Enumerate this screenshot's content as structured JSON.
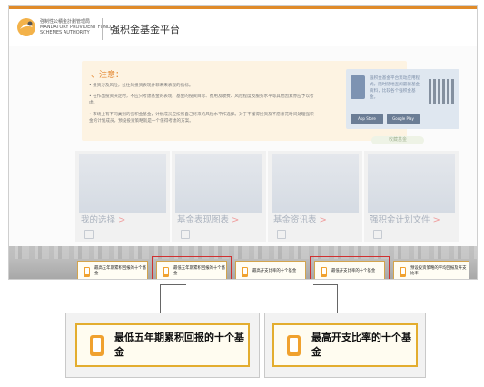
{
  "header": {
    "org_lines": [
      "強制性公積金計劃管理局",
      "MANDATORY PROVIDENT FUND",
      "SCHEMES AUTHORITY"
    ],
    "title": "强积金基金平台"
  },
  "notice": {
    "title": "注意",
    "items": [
      "投资涉及风险，过往的投资表现并非未来表现的指标。",
      "在作出投资决定时，不应只考虑基金的表现，基金的投资目标、费用及收费、风险程度及服务水平等其他因素亦应予以考虑。",
      "市场上有不同类别的强积金基金，计划成员应按照自己将来的风险水平作选择。对于不懂得投资及不愿意花时间处理强积金的计划成员，预设投资策略就是一个值得考虑的方案。"
    ],
    "app_promo": "强积金基金平台流动应用程式，随时随地查阅最新基金资料，比较各个强积金基金。",
    "store_buttons": [
      "App Store",
      "Google Play"
    ],
    "extra_link": "收藏基金"
  },
  "cards": [
    {
      "label": "我的选择",
      "chevron": ">"
    },
    {
      "label": "基金表现图表",
      "chevron": ">"
    },
    {
      "label": "基金资讯表",
      "chevron": ">"
    },
    {
      "label": "强积金计划文件",
      "chevron": ">"
    }
  ],
  "strip_buttons": [
    "最高五年期累积回报的十个基金",
    "最低五年期累积回报的十个基金",
    "最高开支比率的十个基金",
    "最低开支比率的十个基金",
    "预设投资策略的平均回报及开支比率"
  ],
  "callouts": [
    "最低五年期累积回报的十个基金",
    "最高开支比率的十个基金"
  ],
  "colors": {
    "accent": "#e08b2a",
    "highlight": "#d03030",
    "callout_border": "#e3ad2f"
  }
}
